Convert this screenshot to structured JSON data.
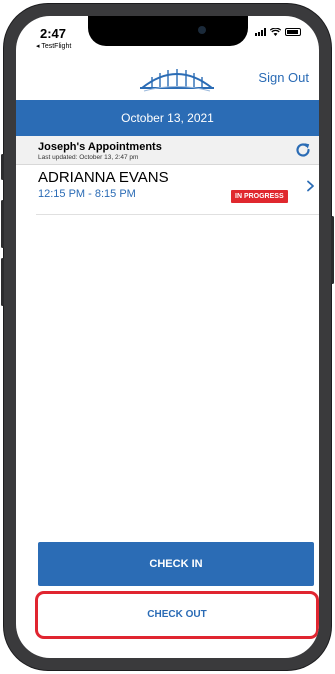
{
  "status_bar": {
    "time": "2:47",
    "back_app": "◂ TestFlight"
  },
  "header": {
    "sign_out_label": "Sign Out"
  },
  "date_bar": {
    "date": "October 13, 2021"
  },
  "appointments": {
    "title": "Joseph's Appointments",
    "last_updated": "Last updated: October 13, 2:47 pm",
    "items": [
      {
        "name": "ADRIANNA EVANS",
        "time": "12:15 PM - 8:15 PM",
        "status": "IN PROGRESS"
      }
    ]
  },
  "actions": {
    "check_in_label": "CHECK IN",
    "check_out_label": "CHECK OUT"
  },
  "colors": {
    "brand_blue": "#2b6cb5",
    "status_red": "#e0282e",
    "highlight_red": "#e02530"
  },
  "icons": {
    "logo": "bridge-logo-icon",
    "refresh": "refresh-icon",
    "chevron": "chevron-right-icon"
  }
}
